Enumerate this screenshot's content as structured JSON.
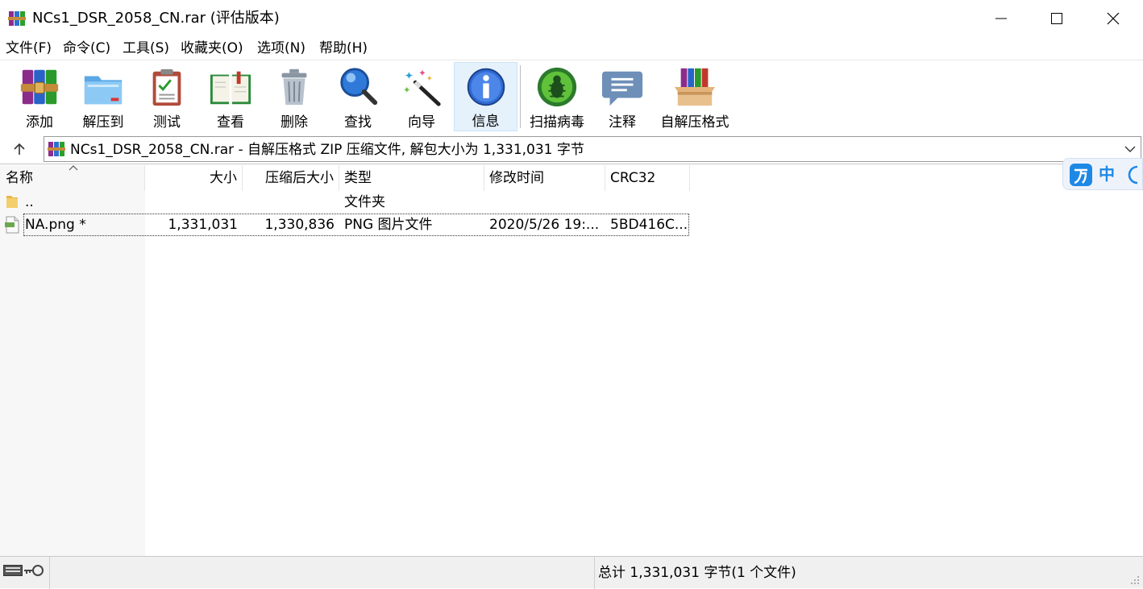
{
  "window": {
    "title": "NCs1_DSR_2058_CN.rar (评估版本)"
  },
  "menu": [
    {
      "label": "文件(F)"
    },
    {
      "label": "命令(C)"
    },
    {
      "label": "工具(S)"
    },
    {
      "label": "收藏夹(O)"
    },
    {
      "label": "选项(N)"
    },
    {
      "label": "帮助(H)"
    }
  ],
  "toolbar": [
    {
      "label": "添加",
      "icon": "books-add-icon"
    },
    {
      "label": "解压到",
      "icon": "folder-extract-icon"
    },
    {
      "label": "测试",
      "icon": "clipboard-check-icon"
    },
    {
      "label": "查看",
      "icon": "open-book-icon"
    },
    {
      "label": "删除",
      "icon": "trash-can-icon"
    },
    {
      "label": "查找",
      "icon": "magnifier-icon"
    },
    {
      "label": "向导",
      "icon": "magic-wand-icon"
    },
    {
      "label": "信息",
      "icon": "info-icon",
      "active": true
    },
    {
      "label": "扫描病毒",
      "icon": "virus-scan-icon"
    },
    {
      "label": "注释",
      "icon": "comment-icon"
    },
    {
      "label": "自解压格式",
      "icon": "sfx-box-icon"
    }
  ],
  "address": {
    "text": "NCs1_DSR_2058_CN.rar - 自解压格式 ZIP 压缩文件, 解包大小为 1,331,031 字节"
  },
  "columns": {
    "name": "名称",
    "size": "大小",
    "packed": "压缩后大小",
    "type": "类型",
    "modified": "修改时间",
    "crc": "CRC32"
  },
  "rows": [
    {
      "name": "..",
      "size": "",
      "packed": "",
      "type": "文件夹",
      "modified": "",
      "crc": ""
    },
    {
      "name": "NA.png *",
      "size": "1,331,031",
      "packed": "1,330,836",
      "type": "PNG 图片文件",
      "modified": "2020/5/26 19:...",
      "crc": "5BD416C..."
    }
  ],
  "ime": {
    "mode": "中"
  },
  "status": {
    "summary": "总计 1,331,031 字节(1 个文件)"
  },
  "colors": {
    "active_button_bg": "#e5f1fb",
    "ime_blue": "#1e88e5",
    "namecol_bg": "#f7f7f7"
  }
}
